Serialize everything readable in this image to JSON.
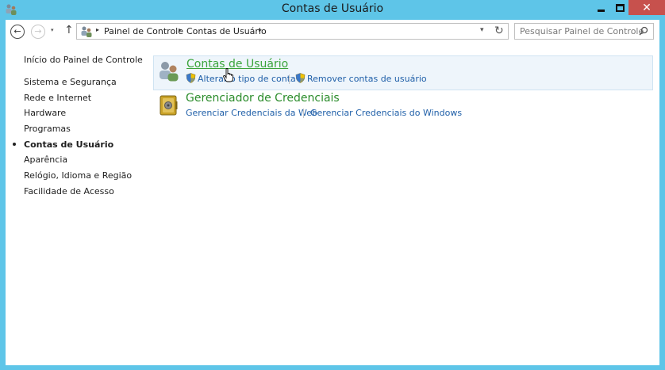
{
  "window": {
    "title": "Contas de Usuário",
    "close_glyph": "✕"
  },
  "nav": {
    "back_glyph": "←",
    "forward_glyph": "→",
    "up_glyph": "↑",
    "recent_glyph": "▾"
  },
  "address": {
    "crumbs": [
      "Painel de Controle",
      "Contas de Usuário"
    ],
    "separator_glyph": "▸",
    "dropdown_glyph": "▾",
    "refresh_glyph": "↻"
  },
  "search": {
    "placeholder": "Pesquisar Painel de Controle"
  },
  "sidebar": {
    "home": "Início do Painel de Controle",
    "items": [
      {
        "label": "Sistema e Segurança"
      },
      {
        "label": "Rede e Internet"
      },
      {
        "label": "Hardware"
      },
      {
        "label": "Programas"
      },
      {
        "label": "Contas de Usuário",
        "current": true
      },
      {
        "label": "Aparência"
      },
      {
        "label": "Relógio, Idioma e Região"
      },
      {
        "label": "Facilidade de Acesso"
      }
    ]
  },
  "categories": [
    {
      "title": "Contas de Usuário",
      "icon": "users-icon",
      "links": [
        {
          "label": "Alterar o tipo de conta",
          "icon": "shield-icon"
        },
        {
          "label": "Remover contas de usuário",
          "icon": "shield-icon"
        }
      ]
    },
    {
      "title": "Gerenciador de Credenciais",
      "icon": "credential-vault-icon",
      "links": [
        {
          "label": "Gerenciar Credenciais da Web"
        },
        {
          "label": "Gerenciar Credenciais do Windows"
        }
      ]
    }
  ],
  "colors": {
    "title_bar": "#5ec5e8",
    "close_button": "#c7514d",
    "category_title": "#2b8c2b",
    "link": "#1f5fa8",
    "hover_bg": "#eef5fb"
  }
}
